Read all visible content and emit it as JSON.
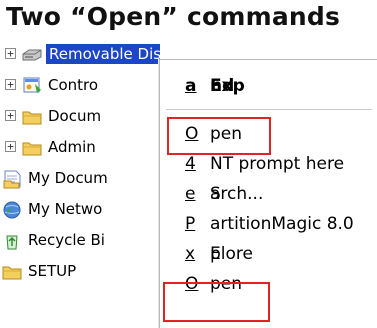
{
  "title": "Two “Open” commands",
  "tree": {
    "items": [
      {
        "label": "Removable Disk (E:)",
        "icon": "removable-disk-icon",
        "expandable": true,
        "selected": true
      },
      {
        "label": "Contro",
        "icon": "control-panel-icon",
        "expandable": true
      },
      {
        "label": "Docum",
        "icon": "folder-icon",
        "expandable": true
      },
      {
        "label": "Admin",
        "icon": "folder-icon",
        "expandable": true
      },
      {
        "label": "My Docum",
        "icon": "my-documents-icon",
        "expandable": false
      },
      {
        "label": "My Netwo",
        "icon": "network-icon",
        "expandable": false
      },
      {
        "label": "Recycle Bi",
        "icon": "recycle-bin-icon",
        "expandable": false
      },
      {
        "label": "SETUP",
        "icon": "folder-icon",
        "expandable": false
      }
    ]
  },
  "context_menu": {
    "items": [
      {
        "pre": "Exp",
        "acc": "a",
        "post": "nd",
        "bold": true
      },
      {
        "pre": "",
        "acc": "O",
        "post": "pen",
        "highlighted": true
      },
      {
        "pre": "",
        "acc": "4",
        "post": "NT prompt here"
      },
      {
        "pre": "S",
        "acc": "e",
        "post": "arch..."
      },
      {
        "pre": "",
        "acc": "P",
        "post": "artitionMagic 8.0"
      },
      {
        "pre": "E",
        "acc": "x",
        "post": "plore"
      },
      {
        "pre": "",
        "acc": "O",
        "post": "pen",
        "highlighted": true
      }
    ]
  },
  "colors": {
    "selection": "#1b46c6",
    "highlight_box": "#e02424"
  }
}
